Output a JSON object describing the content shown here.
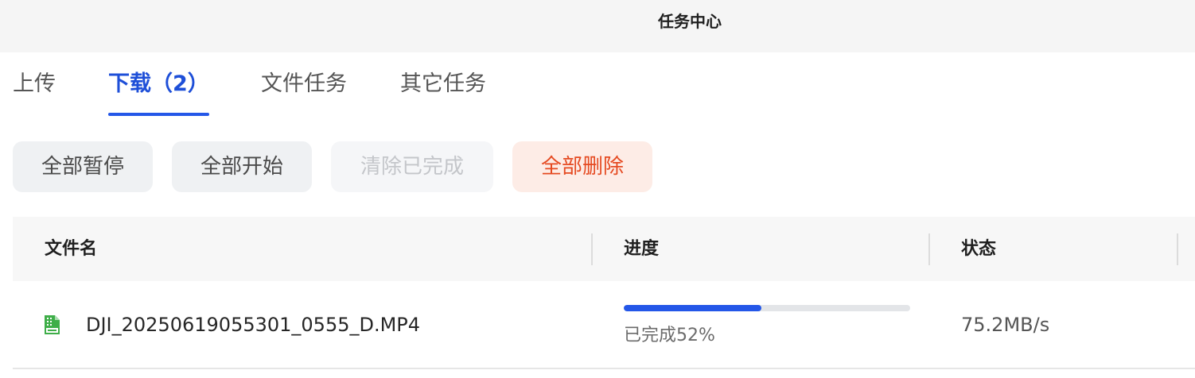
{
  "window": {
    "title": "任务中心"
  },
  "tabs": [
    {
      "label": "上传",
      "active": false
    },
    {
      "label": "下载（2）",
      "active": true
    },
    {
      "label": "文件任务",
      "active": false
    },
    {
      "label": "其它任务",
      "active": false
    }
  ],
  "toolbar": {
    "pause_all": "全部暂停",
    "start_all": "全部开始",
    "clear_completed": "清除已完成",
    "delete_all": "全部删除"
  },
  "table": {
    "columns": [
      "文件名",
      "进度",
      "状态"
    ],
    "rows": [
      {
        "icon": "video-file-icon",
        "filename": "DJI_20250619055301_0555_D.MP4",
        "progress_fraction": 0.48,
        "progress_text": "已完成52%",
        "status": "75.2MB/s"
      }
    ]
  },
  "colors": {
    "accent": "#2457e8",
    "danger": "#e54a21",
    "file_icon": "#3fae49"
  }
}
